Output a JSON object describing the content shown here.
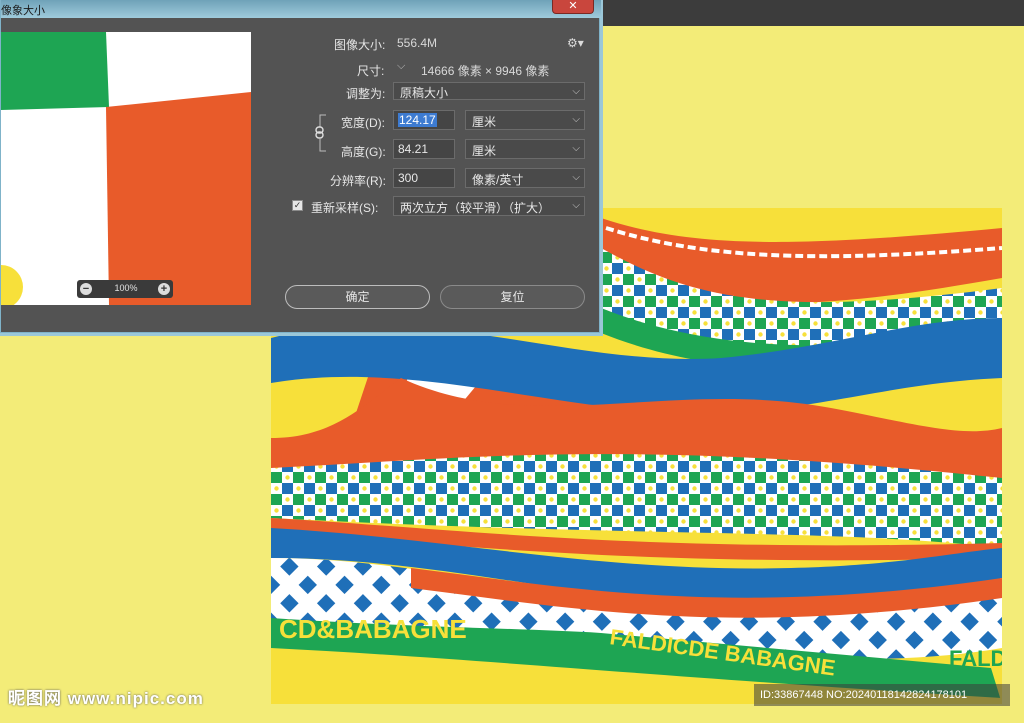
{
  "dialog": {
    "title": "像象大小",
    "close_label": "✕",
    "image_size_label": "图像大小:",
    "image_size_value": "556.4M",
    "dimensions_label": "尺寸:",
    "dimensions_value": "14666 像素 × 9946 像素",
    "fit_to_label": "调整为:",
    "fit_to_value": "原稿大小",
    "width_label": "宽度(D):",
    "width_value": "124.17",
    "width_unit": "厘米",
    "height_label": "高度(G):",
    "height_value": "84.21",
    "height_unit": "厘米",
    "resolution_label": "分辨率(R):",
    "resolution_value": "300",
    "resolution_unit": "像素/英寸",
    "resample_label": "重新采样(S):",
    "resample_checked": "✓",
    "resample_value": "两次立方（较平滑）（扩大）",
    "ok_label": "确定",
    "reset_label": "复位",
    "zoom_value": "100%",
    "zoom_minus": "−",
    "zoom_plus": "+"
  },
  "watermark": {
    "site": "昵图网 www.nipic.com",
    "id_text": "ID:33867448 NO:20240118142824178101"
  },
  "artwork": {
    "banner_text_1": "CD&BABAGNE",
    "banner_text_2": "FALDICDE BABAGNE",
    "banner_text_3": "FALD",
    "banner_text_4": "DICDE"
  },
  "colors": {
    "background": "#f3ec78",
    "dialog": "#535353",
    "orange": "#e85b2a",
    "blue": "#1f6fb8",
    "green": "#1ea553",
    "yellow": "#f7e03a"
  }
}
